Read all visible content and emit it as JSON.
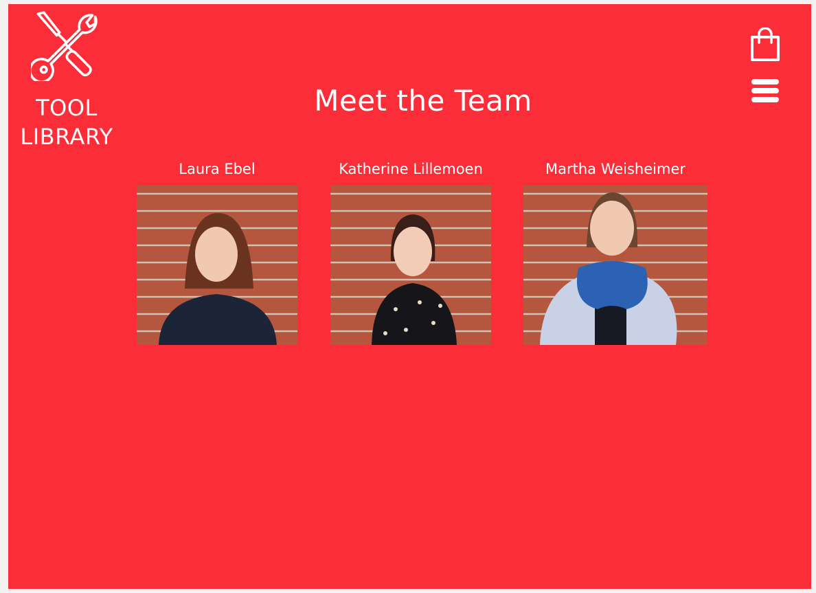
{
  "header": {
    "logo_line1": "TOOL",
    "logo_line2": "LIBRARY",
    "logo_icon": "tools-icon",
    "cart_icon": "shopping-bag-icon",
    "menu_icon": "hamburger-menu-icon"
  },
  "page": {
    "title": "Meet the Team"
  },
  "team": [
    {
      "name": "Laura Ebel"
    },
    {
      "name": "Katherine Lillemoen"
    },
    {
      "name": "Martha Weisheimer"
    }
  ],
  "colors": {
    "background": "#fb2d38",
    "text": "#ffffff"
  }
}
